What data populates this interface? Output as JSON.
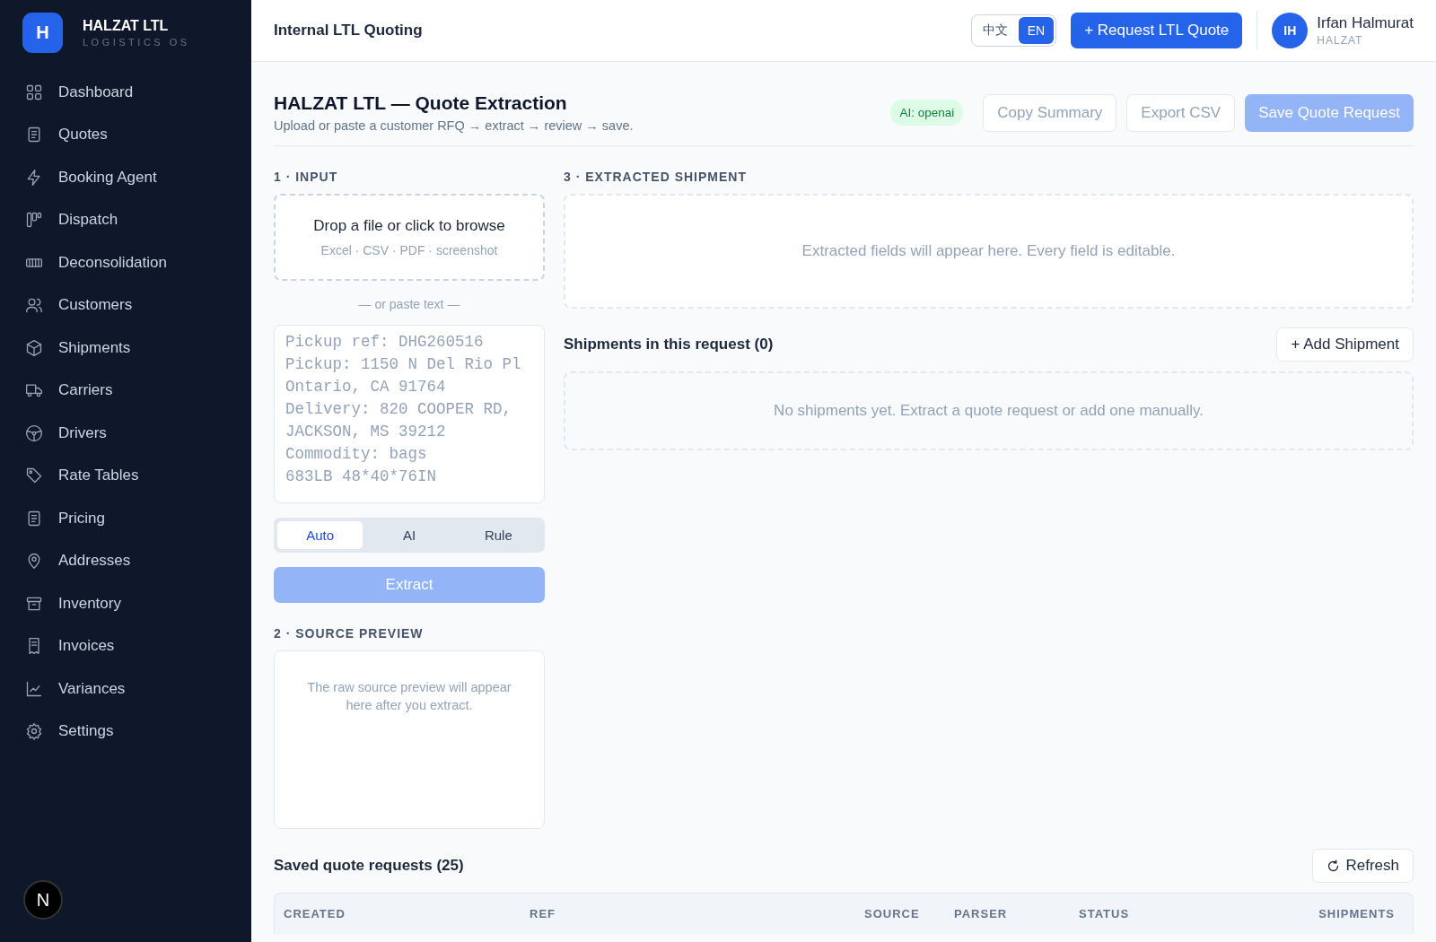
{
  "sidebar": {
    "logo_letter": "H",
    "brand": "HALZAT LTL",
    "tagline": "LOGISTICS OS",
    "items": [
      {
        "label": "Dashboard",
        "selected": false
      },
      {
        "label": "Quotes",
        "selected": false
      },
      {
        "label": "Booking Agent",
        "selected": false
      },
      {
        "label": "Dispatch",
        "selected": false
      },
      {
        "label": "Deconsolidation",
        "selected": false
      },
      {
        "label": "Customers",
        "selected": false
      },
      {
        "label": "Shipments",
        "selected": false
      },
      {
        "label": "Carriers",
        "selected": false
      },
      {
        "label": "Drivers",
        "selected": false
      },
      {
        "label": "Rate Tables",
        "selected": false
      },
      {
        "label": "Pricing",
        "selected": false
      },
      {
        "label": "Addresses",
        "selected": false
      },
      {
        "label": "Inventory",
        "selected": false
      },
      {
        "label": "Invoices",
        "selected": false
      },
      {
        "label": "Variances",
        "selected": false
      },
      {
        "label": "Settings",
        "selected": false
      }
    ],
    "dev_badge": "N"
  },
  "header": {
    "title": "Internal LTL Quoting",
    "languages": [
      {
        "label": "中文",
        "selected": false
      },
      {
        "label": "EN",
        "selected": true
      }
    ],
    "primary_button": "+ Request LTL Quote",
    "user": {
      "initials": "IH",
      "name": "Irfan Halmurat",
      "org": "HALZAT"
    }
  },
  "page": {
    "title": "HALZAT LTL — Quote Extraction",
    "subtitle": "Upload or paste a customer RFQ → extract → review → save.",
    "ai_badge": "AI: openai",
    "actions": [
      {
        "label": "Copy Summary",
        "kind": "outline"
      },
      {
        "label": "Export CSV",
        "kind": "outline"
      },
      {
        "label": "Save Quote Request",
        "kind": "primary",
        "disabled": true
      }
    ]
  },
  "input": {
    "heading": "1 · INPUT",
    "drop_title": "Drop a file or click to browse",
    "drop_hint": "Excel · CSV · PDF · screenshot",
    "divider": "— or paste text —",
    "placeholder": "Pickup ref: DHG260516\nPickup: 1150 N Del Rio Pl\nOntario, CA 91764\nDelivery: 820 COOPER RD,\nJACKSON, MS 39212\nCommodity: bags\n683LB 48*40*76IN",
    "modes": [
      {
        "label": "Auto",
        "selected": true
      },
      {
        "label": "AI",
        "selected": false
      },
      {
        "label": "Rule",
        "selected": false
      }
    ],
    "extract_button": "Extract",
    "extract_disabled": true
  },
  "source_preview": {
    "heading": "2 · SOURCE PREVIEW",
    "empty": "The raw source preview will appear here after you extract."
  },
  "extracted": {
    "heading": "3 · EXTRACTED SHIPMENT",
    "empty": "Extracted fields will appear here. Every field is editable."
  },
  "shipments": {
    "title": "Shipments in this request (0)",
    "add_button": "+ Add Shipment",
    "empty": "No shipments yet. Extract a quote request or add one manually."
  },
  "saved": {
    "title": "Saved quote requests (25)",
    "refresh_button": "Refresh",
    "table": {
      "columns": [
        "CREATED",
        "REF",
        "SOURCE",
        "PARSER",
        "STATUS",
        "SHIPMENTS"
      ]
    }
  }
}
